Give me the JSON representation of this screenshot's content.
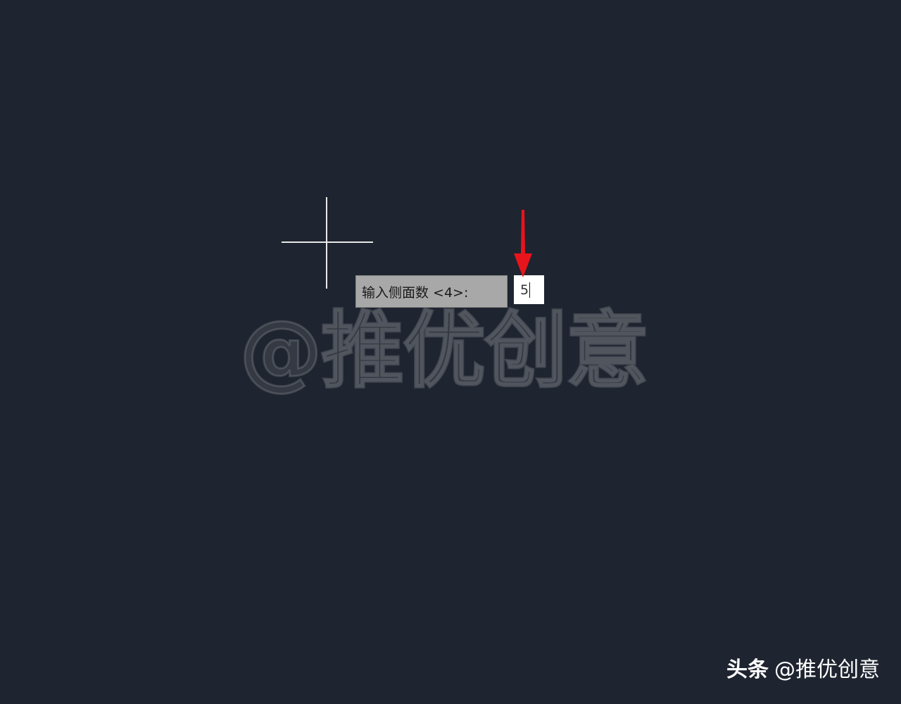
{
  "prompt": {
    "label": "输入侧面数 <4>:",
    "input_value": "5"
  },
  "watermark": {
    "center_text": "@推优创意",
    "corner_brand": "头条",
    "corner_account": "@推优创意"
  },
  "colors": {
    "canvas_bg": "#1e2430",
    "crosshair": "#e8e8e8",
    "prompt_bg": "#a8a8a8",
    "input_bg": "#ffffff",
    "arrow": "#e8141c"
  },
  "icons": {
    "cursor": "crosshair-cursor-icon",
    "annotation": "red-arrow-down-icon"
  }
}
